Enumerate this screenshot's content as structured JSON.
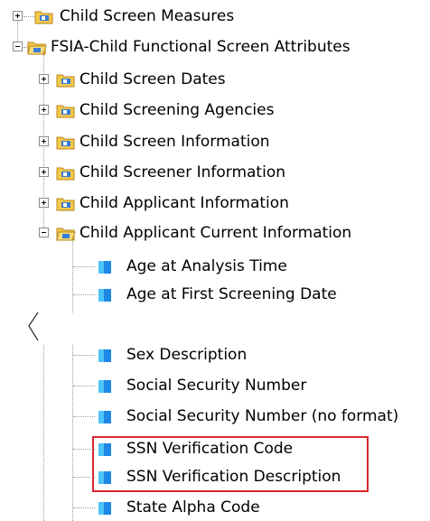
{
  "tree": {
    "nodes": [
      {
        "label": "Child Screen Measures",
        "type": "folder",
        "state": "collapsed"
      },
      {
        "label": "FSIA-Child Functional Screen Attributes",
        "type": "folder",
        "state": "expanded"
      },
      {
        "label": "Child Screen Dates",
        "type": "folder",
        "state": "collapsed"
      },
      {
        "label": "Child Screening Agencies",
        "type": "folder",
        "state": "collapsed"
      },
      {
        "label": "Child Screen Information",
        "type": "folder",
        "state": "collapsed"
      },
      {
        "label": "Child Screener Information",
        "type": "folder",
        "state": "collapsed"
      },
      {
        "label": "Child Applicant Information",
        "type": "folder",
        "state": "collapsed"
      },
      {
        "label": "Child Applicant Current Information",
        "type": "folder",
        "state": "expanded"
      },
      {
        "label": "Age at Analysis Time",
        "type": "dimension"
      },
      {
        "label": "Age at First Screening Date",
        "type": "dimension"
      },
      {
        "label": "Sex Description",
        "type": "dimension"
      },
      {
        "label": "Social Security Number",
        "type": "dimension"
      },
      {
        "label": "Social Security Number (no format)",
        "type": "dimension"
      },
      {
        "label": "SSN Verification Code",
        "type": "dimension",
        "highlighted": true
      },
      {
        "label": "SSN Verification Description",
        "type": "dimension",
        "highlighted": true
      },
      {
        "label": "State Alpha Code",
        "type": "dimension"
      }
    ]
  },
  "colors": {
    "highlight_border": "#d9262c",
    "folder": "#f2c94c",
    "dimension_icon": "#1e88e5"
  },
  "icons": {
    "folder": "folder-icon",
    "dimension": "dimension-icon",
    "expand": "plus-box-icon",
    "collapse": "minus-box-icon"
  }
}
